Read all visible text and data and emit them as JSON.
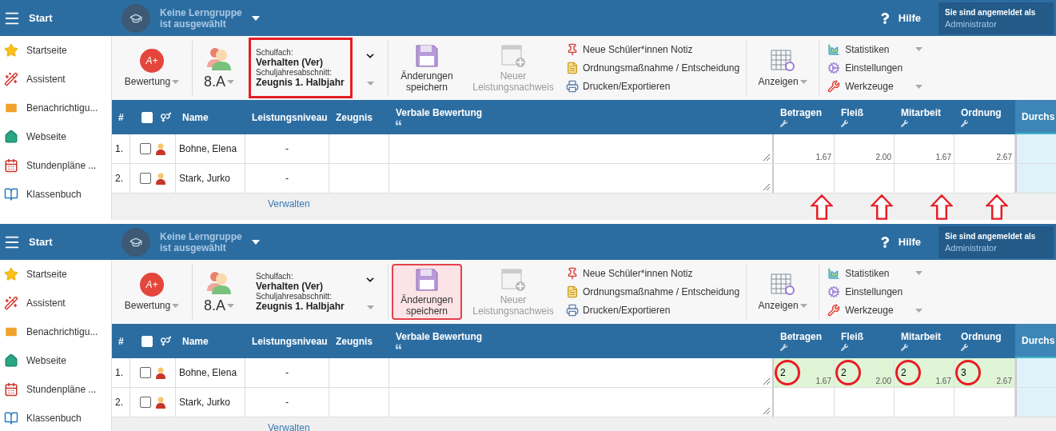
{
  "panels": [
    {
      "menu_label": "Start",
      "group": {
        "line1": "Keine Lerngruppe",
        "line2": "ist ausgewählt"
      },
      "help": "Hilfe",
      "login": {
        "label": "Sie sind angemeldet als",
        "user": "Administrator"
      },
      "sidebar": [
        {
          "label": "Startseite",
          "kind": "star"
        },
        {
          "label": "Assistent",
          "kind": "wand"
        },
        {
          "label": "Benachrichtigu...",
          "kind": "mail"
        },
        {
          "label": "Webseite",
          "kind": "house"
        },
        {
          "label": "Stundenpläne ...",
          "kind": "calendar"
        },
        {
          "label": "Klassenbuch",
          "kind": "book"
        }
      ],
      "toolbar": {
        "grading_badge": "A+",
        "grading": "Bewertung",
        "class_name": "8.A",
        "subject_label": "Schulfach:",
        "subject": "Verhalten (Ver)",
        "period_label": "Schuljahresabschnitt:",
        "period": "Zeugnis 1. Halbjahr",
        "selector_marked": true,
        "save": {
          "label": "Änderungen speichern",
          "pending": false
        },
        "new_assessment": {
          "label": "Neuer Leistungsnachweis",
          "disabled": true
        },
        "actions": [
          {
            "label": "Neue Schüler*innen Notiz",
            "kind": "pin"
          },
          {
            "label": "Ordnungsmaßnahme / Entscheidung",
            "kind": "document"
          },
          {
            "label": "Drucken/Exportieren",
            "kind": "printer"
          }
        ],
        "view": "Anzeigen",
        "tools": [
          {
            "label": "Statistiken",
            "kind": "stats",
            "dropdown": true
          },
          {
            "label": "Einstellungen",
            "kind": "gears",
            "dropdown": false
          },
          {
            "label": "Werkzeuge",
            "kind": "tools",
            "dropdown": true
          }
        ]
      },
      "table": {
        "number": "#",
        "name": "Name",
        "level": "Leistungsniveau",
        "report": "Zeugnis",
        "verbal": "Verbale Bewertung",
        "average": "Durchs",
        "header_checked": false,
        "grades": [
          {
            "label": "Betragen",
            "arrow": true
          },
          {
            "label": "Fleiß",
            "arrow": true
          },
          {
            "label": "Mitarbeit",
            "arrow": true
          },
          {
            "label": "Ordnung",
            "arrow": true
          }
        ],
        "rows": [
          {
            "number": "1.",
            "name": "Bohne, Elena",
            "level": "-",
            "checked": false,
            "grades": [
              {
                "average": "1.67"
              },
              {
                "average": "2.00"
              },
              {
                "average": "1.67"
              },
              {
                "average": "2.67"
              }
            ]
          },
          {
            "number": "2.",
            "name": "Stark, Jurko",
            "level": "-",
            "checked": false
          }
        ],
        "footer": "Verwalten"
      }
    },
    {
      "menu_label": "Start",
      "group": {
        "line1": "Keine Lerngruppe",
        "line2": "ist ausgewählt"
      },
      "help": "Hilfe",
      "login": {
        "label": "Sie sind angemeldet als",
        "user": "Administrator"
      },
      "sidebar": [
        {
          "label": "Startseite",
          "kind": "star"
        },
        {
          "label": "Assistent",
          "kind": "wand"
        },
        {
          "label": "Benachrichtigu...",
          "kind": "mail"
        },
        {
          "label": "Webseite",
          "kind": "house"
        },
        {
          "label": "Stundenpläne ...",
          "kind": "calendar"
        },
        {
          "label": "Klassenbuch",
          "kind": "book"
        }
      ],
      "toolbar": {
        "grading_badge": "A+",
        "grading": "Bewertung",
        "class_name": "8.A",
        "subject_label": "Schulfach:",
        "subject": "Verhalten (Ver)",
        "period_label": "Schuljahresabschnitt:",
        "period": "Zeugnis 1. Halbjahr",
        "selector_marked": false,
        "save": {
          "label": "Änderungen speichern",
          "pending": true
        },
        "new_assessment": {
          "label": "Neuer Leistungsnachweis",
          "disabled": true
        },
        "actions": [
          {
            "label": "Neue Schüler*innen Notiz",
            "kind": "pin"
          },
          {
            "label": "Ordnungsmaßnahme / Entscheidung",
            "kind": "document"
          },
          {
            "label": "Drucken/Exportieren",
            "kind": "printer"
          }
        ],
        "view": "Anzeigen",
        "tools": [
          {
            "label": "Statistiken",
            "kind": "stats",
            "dropdown": true
          },
          {
            "label": "Einstellungen",
            "kind": "gears",
            "dropdown": false
          },
          {
            "label": "Werkzeuge",
            "kind": "tools",
            "dropdown": true
          }
        ]
      },
      "table": {
        "number": "#",
        "name": "Name",
        "level": "Leistungsniveau",
        "report": "Zeugnis",
        "verbal": "Verbale Bewertung",
        "average": "Durchs",
        "header_checked": false,
        "grades": [
          {
            "label": "Betragen"
          },
          {
            "label": "Fleiß"
          },
          {
            "label": "Mitarbeit"
          },
          {
            "label": "Ordnung"
          }
        ],
        "rows": [
          {
            "number": "1.",
            "name": "Bohne, Elena",
            "level": "-",
            "checked": false,
            "grades": [
              {
                "value": "2",
                "average": "1.67",
                "circled": true
              },
              {
                "value": "2",
                "average": "2.00",
                "circled": true
              },
              {
                "value": "2",
                "average": "1.67",
                "circled": true
              },
              {
                "value": "3",
                "average": "2.67",
                "circled": true
              }
            ]
          },
          {
            "number": "2.",
            "name": "Stark, Jurko",
            "level": "-",
            "checked": false
          }
        ],
        "footer": "Verwalten"
      }
    }
  ]
}
